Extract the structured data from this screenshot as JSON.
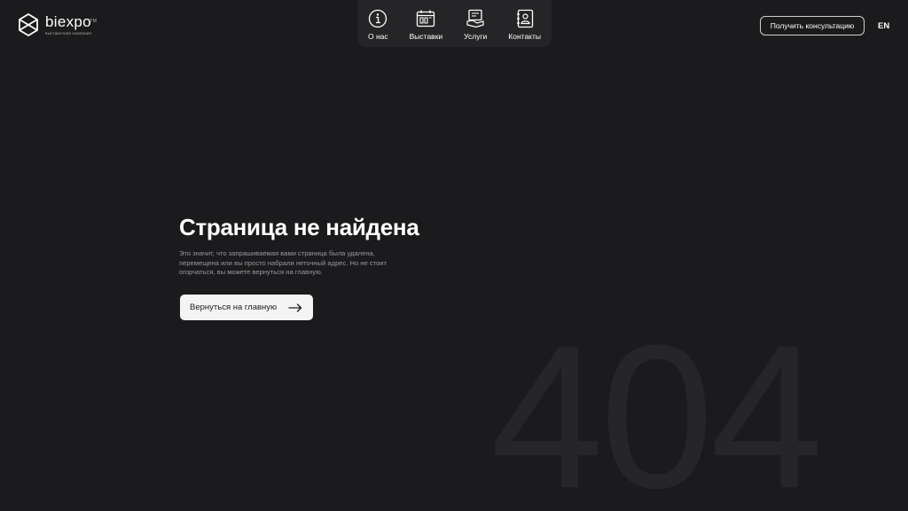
{
  "header": {
    "logo": {
      "name": "biexpo",
      "trademark": "TM",
      "tagline": "выставочная компания"
    },
    "nav": [
      {
        "label": "О нас",
        "icon": "info-icon"
      },
      {
        "label": "Выставки",
        "icon": "exhibition-calendar-icon"
      },
      {
        "label": "Услуги",
        "icon": "services-icon"
      },
      {
        "label": "Контакты",
        "icon": "contacts-book-icon"
      }
    ],
    "cta_label": "Получить консультацию",
    "lang": "EN"
  },
  "main": {
    "title": "Страница не найдена",
    "description": "Это значит, что запрашиваемая вами страница была удалена, перемещена или вы просто набрали неточный адрес. Но не стоит огорчаться, вы можете вернуться на главную.",
    "home_button": "Вернуться на главную",
    "error_code": "404"
  },
  "colors": {
    "background": "#1b1b1d",
    "nav_background": "#252527",
    "text_muted": "#9a9a9d",
    "watermark": "#262628",
    "button_light": "#f4f4f4"
  }
}
